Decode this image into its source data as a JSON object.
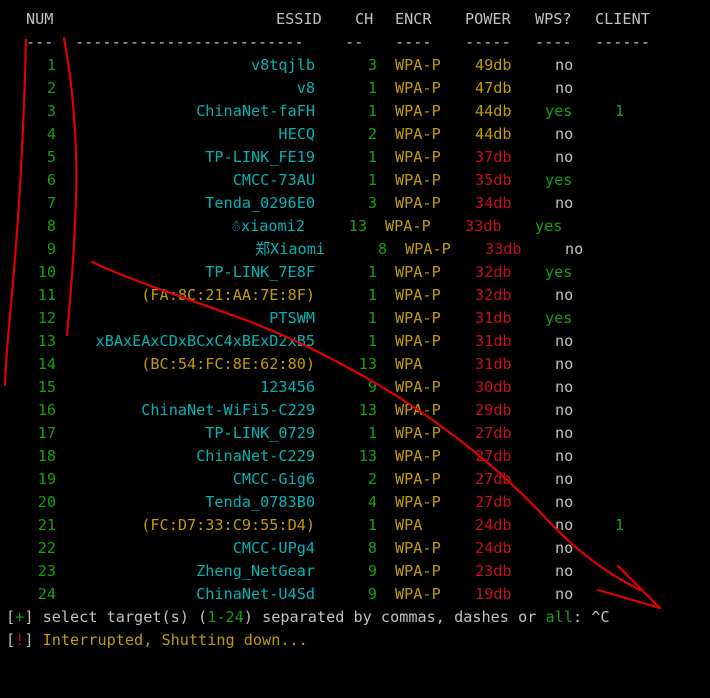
{
  "header": {
    "num": "NUM",
    "essid": "ESSID",
    "ch": "CH",
    "encr": "ENCR",
    "power": "POWER",
    "wps": "WPS?",
    "client": "CLIENT"
  },
  "separators": {
    "num": "---",
    "essid": "-------------------------",
    "ch": "--",
    "encr": "----",
    "power": "-----",
    "wps": "----",
    "client": "------"
  },
  "rows": [
    {
      "num": "1",
      "essid": "v8tqjlb",
      "ch": "3",
      "encr": "WPA-P",
      "power": "49db",
      "wps": "no",
      "client": ""
    },
    {
      "num": "2",
      "essid": "v8",
      "ch": "1",
      "encr": "WPA-P",
      "power": "47db",
      "wps": "no",
      "client": ""
    },
    {
      "num": "3",
      "essid": "ChinaNet-faFH",
      "ch": "1",
      "encr": "WPA-P",
      "power": "44db",
      "wps": "yes",
      "client": "1"
    },
    {
      "num": "4",
      "essid": "HECQ",
      "ch": "2",
      "encr": "WPA-P",
      "power": "44db",
      "wps": "no",
      "client": ""
    },
    {
      "num": "5",
      "essid": "TP-LINK_FE19",
      "ch": "1",
      "encr": "WPA-P",
      "power": "37db",
      "wps": "no",
      "client": ""
    },
    {
      "num": "6",
      "essid": "CMCC-73AU",
      "ch": "1",
      "encr": "WPA-P",
      "power": "35db",
      "wps": "yes",
      "client": ""
    },
    {
      "num": "7",
      "essid": "Tenda_0296E0",
      "ch": "3",
      "encr": "WPA-P",
      "power": "34db",
      "wps": "no",
      "client": ""
    },
    {
      "num": "8",
      "essid": "☃xiaomi2",
      "ch": "13",
      "encr": "WPA-P",
      "power": "33db",
      "wps": "yes",
      "client": ""
    },
    {
      "num": "9",
      "essid": "郑Xiaomi",
      "ch": "8",
      "encr": "WPA-P",
      "power": "33db",
      "wps": "no",
      "client": ""
    },
    {
      "num": "10",
      "essid": "TP-LINK_7E8F",
      "ch": "1",
      "encr": "WPA-P",
      "power": "32db",
      "wps": "yes",
      "client": ""
    },
    {
      "num": "11",
      "essid": "(FA:8C:21:AA:7E:8F)",
      "ch": "1",
      "encr": "WPA-P",
      "power": "32db",
      "wps": "no",
      "client": ""
    },
    {
      "num": "12",
      "essid": "PTSWM",
      "ch": "1",
      "encr": "WPA-P",
      "power": "31db",
      "wps": "yes",
      "client": ""
    },
    {
      "num": "13",
      "essid": "xBAxEAxCDxBCxC4xBExD2xB5",
      "ch": "1",
      "encr": "WPA-P",
      "power": "31db",
      "wps": "no",
      "client": ""
    },
    {
      "num": "14",
      "essid": "(BC:54:FC:8E:62:80)",
      "ch": "13",
      "encr": "WPA",
      "power": "31db",
      "wps": "no",
      "client": ""
    },
    {
      "num": "15",
      "essid": "123456",
      "ch": "9",
      "encr": "WPA-P",
      "power": "30db",
      "wps": "no",
      "client": ""
    },
    {
      "num": "16",
      "essid": "ChinaNet-WiFi5-C229",
      "ch": "13",
      "encr": "WPA-P",
      "power": "29db",
      "wps": "no",
      "client": ""
    },
    {
      "num": "17",
      "essid": "TP-LINK_0729",
      "ch": "1",
      "encr": "WPA-P",
      "power": "27db",
      "wps": "no",
      "client": ""
    },
    {
      "num": "18",
      "essid": "ChinaNet-C229",
      "ch": "13",
      "encr": "WPA-P",
      "power": "27db",
      "wps": "no",
      "client": ""
    },
    {
      "num": "19",
      "essid": "CMCC-Gig6",
      "ch": "2",
      "encr": "WPA-P",
      "power": "27db",
      "wps": "no",
      "client": ""
    },
    {
      "num": "20",
      "essid": "Tenda_0783B0",
      "ch": "4",
      "encr": "WPA-P",
      "power": "27db",
      "wps": "no",
      "client": ""
    },
    {
      "num": "21",
      "essid": "(FC:D7:33:C9:55:D4)",
      "ch": "1",
      "encr": "WPA",
      "power": "24db",
      "wps": "no",
      "client": "1"
    },
    {
      "num": "22",
      "essid": "CMCC-UPg4",
      "ch": "8",
      "encr": "WPA-P",
      "power": "24db",
      "wps": "no",
      "client": ""
    },
    {
      "num": "23",
      "essid": "Zheng_NetGear",
      "ch": "9",
      "encr": "WPA-P",
      "power": "23db",
      "wps": "no",
      "client": ""
    },
    {
      "num": "24",
      "essid": "ChinaNet-U4Sd",
      "ch": "9",
      "encr": "WPA-P",
      "power": "19db",
      "wps": "no",
      "client": ""
    }
  ],
  "prompt": {
    "bracket_open": "[",
    "plus": "+",
    "bracket_close": "]",
    "text1": " select target(s) (",
    "range": "1-24",
    "text2": ") separated by commas, dashes or ",
    "all": "all",
    "text3": ": ^C"
  },
  "interrupt": {
    "bracket_open": "[",
    "bang": "!",
    "bracket_close": "]",
    "text": " Interrupted, Shutting down..."
  },
  "colors": {
    "green": "#13a10e",
    "cyan": "#00b4b4",
    "gold": "#c19c00",
    "red": "#c50f1f",
    "white": "#c0c0c0",
    "annotation": "#e00000"
  }
}
